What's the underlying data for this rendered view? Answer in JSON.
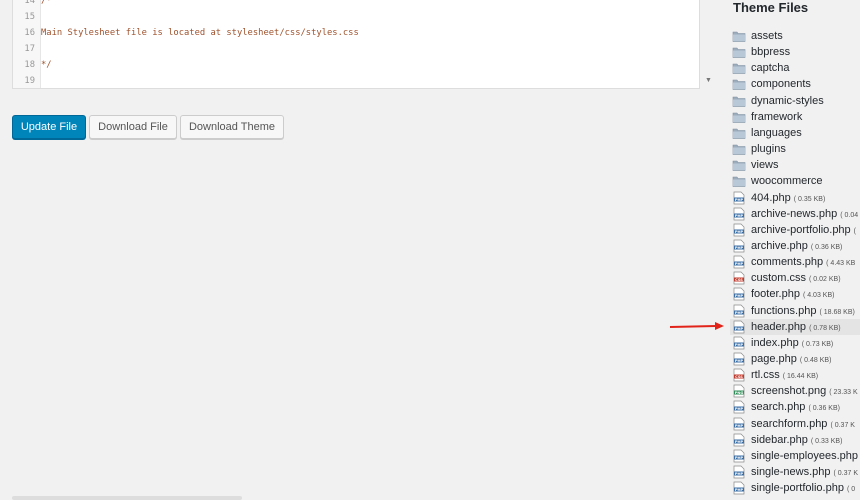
{
  "editor": {
    "lines": [
      {
        "no": "14",
        "text": "/*"
      },
      {
        "no": "15",
        "text": ""
      },
      {
        "no": "16",
        "text": "Main Stylesheet file is located at stylesheet/css/styles.css"
      },
      {
        "no": "17",
        "text": ""
      },
      {
        "no": "18",
        "text": "*/"
      },
      {
        "no": "19",
        "text": ""
      }
    ]
  },
  "actions": {
    "update_label": "Update File",
    "download_file_label": "Download File",
    "download_theme_label": "Download Theme"
  },
  "sidebar": {
    "title": "Theme Files",
    "selected": "header.php",
    "items": [
      {
        "type": "folder",
        "name": "assets",
        "size": ""
      },
      {
        "type": "folder",
        "name": "bbpress",
        "size": ""
      },
      {
        "type": "folder",
        "name": "captcha",
        "size": ""
      },
      {
        "type": "folder",
        "name": "components",
        "size": ""
      },
      {
        "type": "folder",
        "name": "dynamic-styles",
        "size": ""
      },
      {
        "type": "folder",
        "name": "framework",
        "size": ""
      },
      {
        "type": "folder",
        "name": "languages",
        "size": ""
      },
      {
        "type": "folder",
        "name": "plugins",
        "size": ""
      },
      {
        "type": "folder",
        "name": "views",
        "size": ""
      },
      {
        "type": "folder",
        "name": "woocommerce",
        "size": ""
      },
      {
        "type": "php",
        "name": "404.php",
        "size": "( 0.35 KB)"
      },
      {
        "type": "php",
        "name": "archive-news.php",
        "size": "( 0.04"
      },
      {
        "type": "php",
        "name": "archive-portfolio.php",
        "size": "("
      },
      {
        "type": "php",
        "name": "archive.php",
        "size": "( 0.36 KB)"
      },
      {
        "type": "php",
        "name": "comments.php",
        "size": "( 4.43 KB"
      },
      {
        "type": "css",
        "name": "custom.css",
        "size": "( 0.02 KB)"
      },
      {
        "type": "php",
        "name": "footer.php",
        "size": "( 4.03 KB)"
      },
      {
        "type": "php",
        "name": "functions.php",
        "size": "( 18.68 KB)"
      },
      {
        "type": "php",
        "name": "header.php",
        "size": "( 0.78 KB)"
      },
      {
        "type": "php",
        "name": "index.php",
        "size": "( 0.73 KB)"
      },
      {
        "type": "php",
        "name": "page.php",
        "size": "( 0.48 KB)"
      },
      {
        "type": "css",
        "name": "rtl.css",
        "size": "( 16.44 KB)"
      },
      {
        "type": "png",
        "name": "screenshot.png",
        "size": "( 23.33 K"
      },
      {
        "type": "php",
        "name": "search.php",
        "size": "( 0.36 KB)"
      },
      {
        "type": "php",
        "name": "searchform.php",
        "size": "( 0.37 K"
      },
      {
        "type": "php",
        "name": "sidebar.php",
        "size": "( 0.33 KB)"
      },
      {
        "type": "php",
        "name": "single-employees.php",
        "size": ""
      },
      {
        "type": "php",
        "name": "single-news.php",
        "size": "( 0.37 K"
      },
      {
        "type": "php",
        "name": "single-portfolio.php",
        "size": "( 0"
      }
    ]
  },
  "colors": {
    "primary_button": "#0085ba",
    "selected_row": "#e4e4e4",
    "arrow": "#e2231a",
    "folder": "#9dadbd"
  }
}
